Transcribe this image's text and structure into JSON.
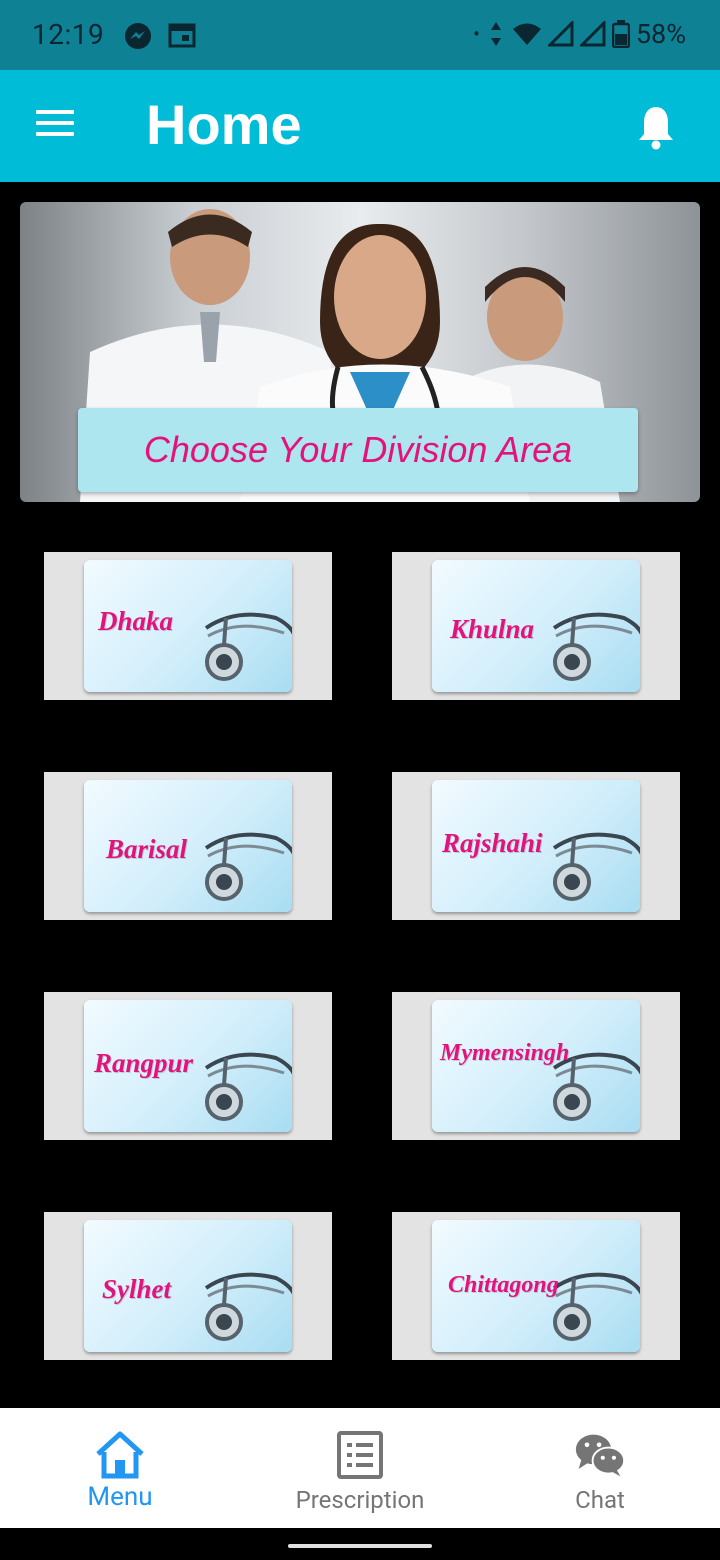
{
  "status_bar": {
    "time": "12:19",
    "battery": "58%"
  },
  "app_bar": {
    "title": "Home"
  },
  "banner": {
    "button_label": "Choose Your Division Area"
  },
  "divisions": [
    {
      "label": "Dhaka"
    },
    {
      "label": "Khulna"
    },
    {
      "label": "Barisal"
    },
    {
      "label": "Rajshahi"
    },
    {
      "label": "Rangpur"
    },
    {
      "label": "Mymensingh"
    },
    {
      "label": "Sylhet"
    },
    {
      "label": "Chittagong"
    }
  ],
  "bottom_nav": {
    "items": [
      {
        "label": "Menu",
        "active": true
      },
      {
        "label": "Prescription",
        "active": false
      },
      {
        "label": "Chat",
        "active": false
      }
    ]
  },
  "colors": {
    "status_bar": "#0e8194",
    "app_bar": "#00bcd6",
    "accent": "#2196f3",
    "division_text": "#e3137d"
  }
}
